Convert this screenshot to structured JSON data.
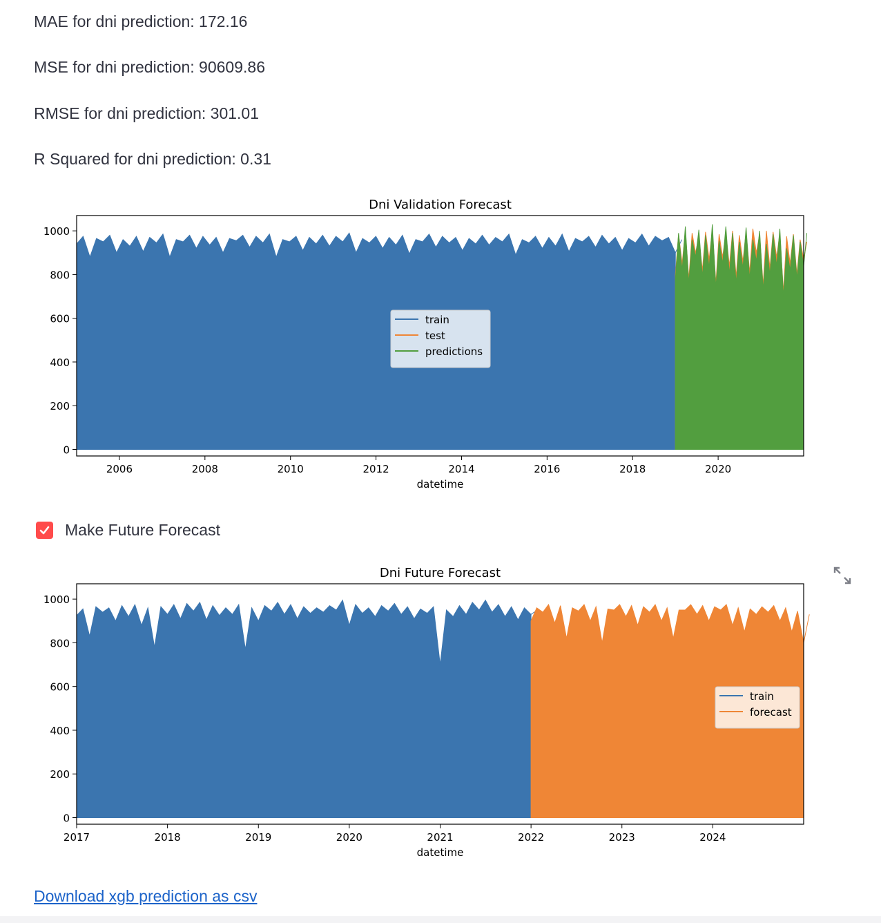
{
  "metrics": {
    "mae": "MAE for dni prediction: 172.16",
    "mse": "MSE for dni prediction: 90609.86",
    "rmse": "RMSE for dni prediction: 301.01",
    "r2": "R Squared for dni prediction: 0.31"
  },
  "checkbox": {
    "label": "Make Future Forecast",
    "checked": true,
    "icon": "checkmark-icon"
  },
  "expand_icon": "expand-icon",
  "download": {
    "label": "Download xgb prediction as csv"
  },
  "chart_data": [
    {
      "type": "area",
      "title": "Dni Validation Forecast",
      "xlabel": "datetime",
      "ylabel": "",
      "xlim": [
        2005.0,
        2022.0
      ],
      "ylim": [
        -30,
        1070
      ],
      "xticks": [
        2006,
        2008,
        2010,
        2012,
        2014,
        2016,
        2018,
        2020
      ],
      "xtick_labels": [
        "2006",
        "2008",
        "2010",
        "2012",
        "2014",
        "2016",
        "2018",
        "2020"
      ],
      "yticks": [
        0,
        200,
        400,
        600,
        800,
        1000
      ],
      "grid": false,
      "legend_position": "center",
      "series": [
        {
          "name": "train",
          "color": "#3b75af",
          "x_range": [
            2005.0,
            2019.0
          ],
          "floor": [
            940,
            880,
            950,
            900,
            930,
            905,
            945,
            880,
            950,
            920,
            935,
            900,
            955,
            925,
            945,
            880,
            950,
            910,
            940,
            930,
            950,
            900,
            945,
            920,
            935,
            895,
            950,
            925,
            945,
            910,
            940,
            935,
            950,
            890,
            945,
            920,
            930,
            905,
            950,
            925,
            940,
            910,
            945,
            930,
            955,
            900
          ],
          "peak": [
            975,
            965,
            980,
            960,
            975,
            970,
            985,
            960,
            980,
            975,
            970,
            965,
            980,
            975,
            985,
            960,
            975,
            970,
            980,
            975,
            990,
            965,
            975,
            970,
            980,
            960,
            985,
            975,
            970,
            965,
            980,
            970,
            985,
            960,
            975,
            970,
            985,
            965,
            975,
            980,
            970,
            965,
            985,
            975,
            970,
            960
          ]
        },
        {
          "name": "test",
          "color": "#ef8636",
          "x_range": [
            2019.0,
            2022.0
          ],
          "floor": [
            800,
            850,
            780,
            900,
            820,
            870,
            760,
            880,
            840,
            790,
            860,
            810,
            900,
            750,
            830,
            880,
            720,
            850,
            800,
            870
          ],
          "peak": [
            985,
            1000,
            990,
            975,
            995,
            1005,
            985,
            990,
            1000,
            980,
            995,
            1010,
            985,
            1000,
            995,
            990,
            975,
            985,
            960,
            950
          ]
        },
        {
          "name": "predictions",
          "color": "#529e3f",
          "x_range": [
            2019.0,
            2022.0
          ],
          "floor": [
            780,
            820,
            760,
            880,
            790,
            830,
            740,
            850,
            800,
            760,
            830,
            780,
            860,
            730,
            800,
            840,
            700,
            820,
            780,
            840
          ],
          "peak": [
            990,
            1020,
            960,
            1005,
            980,
            1030,
            955,
            1020,
            990,
            950,
            1015,
            960,
            1000,
            940,
            985,
            1010,
            920,
            980,
            950,
            990
          ]
        }
      ]
    },
    {
      "type": "area",
      "title": "Dni Future Forecast",
      "xlabel": "datetime",
      "ylabel": "",
      "xlim": [
        2017.0,
        2025.0
      ],
      "ylim": [
        -30,
        1070
      ],
      "xticks": [
        2017,
        2018,
        2019,
        2020,
        2021,
        2022,
        2023,
        2024
      ],
      "xtick_labels": [
        "2017",
        "2018",
        "2019",
        "2020",
        "2021",
        "2022",
        "2023",
        "2024"
      ],
      "yticks": [
        0,
        200,
        400,
        600,
        800,
        1000
      ],
      "grid": false,
      "legend_position": "center-right",
      "series": [
        {
          "name": "train",
          "color": "#3b75af",
          "x_range": [
            2017.0,
            2022.0
          ],
          "floor": [
            925,
            830,
            940,
            900,
            920,
            880,
            780,
            930,
            910,
            945,
            905,
            925,
            930,
            770,
            900,
            945,
            930,
            910,
            935,
            940,
            950,
            880,
            935,
            920,
            945,
            930,
            910,
            935,
            700,
            920,
            930,
            950,
            940,
            920,
            905,
            930
          ],
          "peak": [
            955,
            965,
            960,
            970,
            975,
            960,
            965,
            975,
            980,
            985,
            970,
            960,
            975,
            960,
            970,
            985,
            975,
            965,
            960,
            970,
            995,
            975,
            960,
            970,
            980,
            965,
            955,
            965,
            950,
            970,
            985,
            995,
            975,
            965,
            960,
            950
          ]
        },
        {
          "name": "forecast",
          "color": "#ef8636",
          "x_range": [
            2022.0,
            2025.0
          ],
          "floor": [
            900,
            940,
            890,
            820,
            945,
            900,
            800,
            950,
            920,
            880,
            940,
            900,
            820,
            950,
            930,
            900,
            950,
            880,
            850,
            930,
            940,
            900,
            850,
            800
          ],
          "peak": [
            960,
            975,
            970,
            960,
            975,
            965,
            955,
            975,
            970,
            965,
            975,
            960,
            950,
            975,
            970,
            965,
            975,
            960,
            955,
            965,
            970,
            960,
            945,
            930
          ]
        }
      ]
    }
  ]
}
